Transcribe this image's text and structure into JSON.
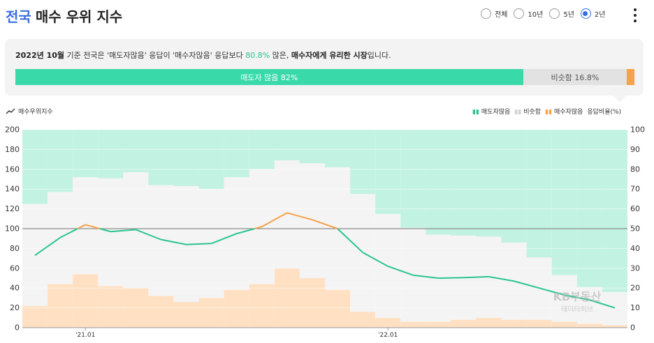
{
  "header": {
    "title_region": "전국",
    "title_rest": "매수 우위 지수"
  },
  "period_options": [
    {
      "label": "전체",
      "selected": false
    },
    {
      "label": "10년",
      "selected": false
    },
    {
      "label": "5년",
      "selected": false
    },
    {
      "label": "2년",
      "selected": true
    }
  ],
  "summary": {
    "date": "2022년 10월",
    "t1": " 기준 전국은 '매도자많음' 응답이 '매수자많음' 응답보다 ",
    "pct": "80.8%",
    "t2": " 많은, ",
    "bold": "매수자에게 유리한 시장",
    "t3": "입니다."
  },
  "ratio_bar": {
    "sell_label": "매도자 많음 82%",
    "same_label": "비슷함 16.8%",
    "sell": 82,
    "same": 16.8,
    "buy": 1.2
  },
  "legend": {
    "index": "매수우위지수",
    "sell": "매도자많음",
    "same": "비슷함",
    "buy": "매수자많음",
    "ratio": "응답비율(%)"
  },
  "colors": {
    "sell": "#3ad9aa",
    "sell_fill": "#c2f2e2",
    "same_fill": "#f4f4f4",
    "buy_fill": "#ffe0c2",
    "index_green": "#2bc58f",
    "index_orange": "#f7a14a",
    "accent": "#3a6fe0"
  },
  "watermark": {
    "line1": "KB부동산",
    "line2": "데이터허브"
  },
  "chart_data": {
    "type": "bar",
    "x": [
      "2020-11",
      "2020-12",
      "2021-01",
      "2021-02",
      "2021-03",
      "2021-04",
      "2021-05",
      "2021-06",
      "2021-07",
      "2021-08",
      "2021-09",
      "2021-10",
      "2021-11",
      "2021-12",
      "2022-01",
      "2022-02",
      "2022-03",
      "2022-04",
      "2022-05",
      "2022-06",
      "2022-07",
      "2022-08",
      "2022-09",
      "2022-10"
    ],
    "x_tick_labels": [
      {
        "x": "2021-01",
        "label": "'21.01"
      },
      {
        "x": "2022-01",
        "label": "'22.01"
      }
    ],
    "series": [
      {
        "name": "매수자많음",
        "axis": "right",
        "values": [
          11,
          22,
          27,
          21,
          20,
          16,
          13,
          15,
          19,
          22,
          30,
          25,
          19,
          8,
          5,
          3,
          3,
          4,
          5,
          4,
          4,
          3,
          2,
          1.2
        ]
      },
      {
        "name": "비슷함",
        "axis": "right",
        "values": [
          51.5,
          46.5,
          49,
          54.5,
          58.5,
          56,
          58.5,
          55,
          57,
          58,
          54.5,
          58,
          62,
          59.5,
          52.5,
          47.5,
          44,
          42.5,
          41,
          39,
          31.5,
          23.5,
          18.5,
          16.8
        ]
      },
      {
        "name": "매도자많음",
        "axis": "right",
        "values": [
          37.5,
          31.5,
          24,
          24.5,
          21.5,
          28,
          28.5,
          30,
          24,
          20,
          15.5,
          17,
          19,
          32.5,
          42.5,
          49.5,
          53,
          53.5,
          54,
          57,
          64.5,
          73.5,
          79.5,
          82
        ]
      },
      {
        "name": "매수우위지수",
        "axis": "left",
        "type": "line",
        "values": [
          73,
          91,
          104,
          97,
          99,
          89,
          84,
          85,
          95,
          102,
          116,
          109,
          100,
          76,
          62,
          53,
          50,
          50.5,
          51.5,
          47,
          40,
          33,
          28,
          20
        ]
      }
    ],
    "threshold": 100,
    "ylim_left": [
      0,
      200
    ],
    "ylim_right": [
      0,
      100
    ],
    "yticks_left": [
      0,
      20,
      40,
      60,
      80,
      100,
      120,
      140,
      160,
      180,
      200
    ],
    "yticks_right": [
      0,
      10,
      20,
      30,
      40,
      50,
      60,
      70,
      80,
      90,
      100
    ]
  }
}
